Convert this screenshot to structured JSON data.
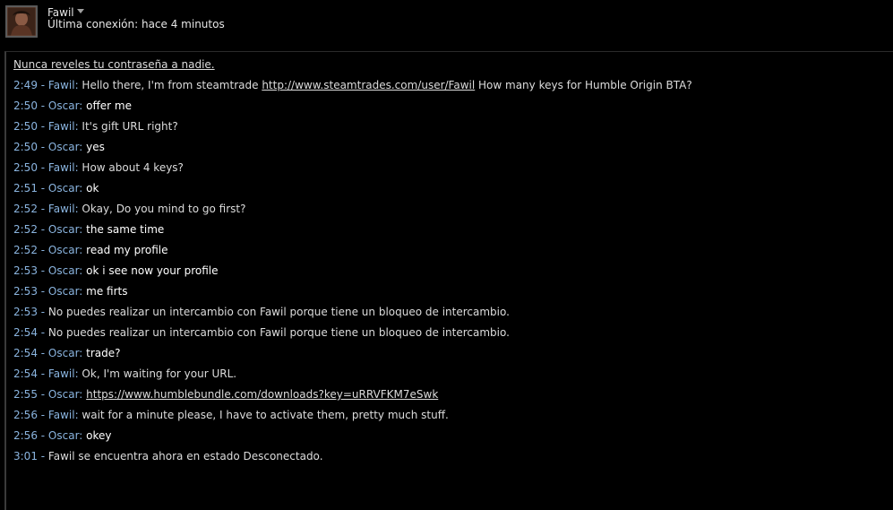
{
  "header": {
    "friend_name": "Fawil",
    "last_seen": "Última conexión: hace 4 minutos"
  },
  "chat": {
    "warning": "Nunca reveles tu contraseña a nadie.",
    "messages": [
      {
        "time": "2:49",
        "sender": "Fawil",
        "pre": "Hello there, I'm from steamtrade ",
        "link": "http://www.steamtrades.com/user/Fawil",
        "post": " How many keys for Humble Origin BTA?"
      },
      {
        "time": "2:50",
        "sender": "Oscar",
        "text": "offer me"
      },
      {
        "time": "2:50",
        "sender": "Fawil",
        "text": "It's gift URL right?"
      },
      {
        "time": "2:50",
        "sender": "Oscar",
        "text": "yes"
      },
      {
        "time": "2:50",
        "sender": "Fawil",
        "text": "How about 4 keys?"
      },
      {
        "time": "2:51",
        "sender": "Oscar",
        "text": "ok"
      },
      {
        "time": "2:52",
        "sender": "Fawil",
        "text": "Okay, Do you mind to go first?"
      },
      {
        "time": "2:52",
        "sender": "Oscar",
        "text": "the same time"
      },
      {
        "time": "2:52",
        "sender": "Oscar",
        "text": "read my profile"
      },
      {
        "time": "2:53",
        "sender": "Oscar",
        "text": "ok i see now your profile"
      },
      {
        "time": "2:53",
        "sender": "Oscar",
        "text": "me firts"
      },
      {
        "time": "2:53",
        "system": "No puedes realizar un intercambio con Fawil porque tiene un bloqueo de intercambio."
      },
      {
        "time": "2:54",
        "system": "No puedes realizar un intercambio con Fawil porque tiene un bloqueo de intercambio."
      },
      {
        "time": "2:54",
        "sender": "Oscar",
        "text": "trade?"
      },
      {
        "time": "2:54",
        "sender": "Fawil",
        "text": "Ok, I'm waiting for your URL."
      },
      {
        "time": "2:55",
        "sender": "Oscar",
        "link": "https://www.humblebundle.com/downloads?key=uRRVFKM7eSwk"
      },
      {
        "time": "2:56",
        "sender": "Fawil",
        "text": "wait for a minute please, I have to activate them, pretty much stuff."
      },
      {
        "time": "2:56",
        "sender": "Oscar",
        "text": "okey"
      },
      {
        "time": "3:01",
        "system": "Fawil se encuentra ahora en estado Desconectado."
      }
    ]
  },
  "colors": {
    "background": "#000000",
    "meta_blue": "#8ab4df",
    "text_gray": "#dcdcdc",
    "text_white": "#ffffff"
  },
  "icons": {
    "dropdown": "chevron-down-icon",
    "avatar": "avatar"
  }
}
